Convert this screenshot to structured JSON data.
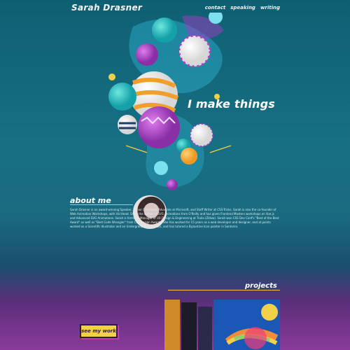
{
  "header": {
    "brand": "Sarah Drasner",
    "nav": [
      {
        "label": "contact"
      },
      {
        "label": "speaking"
      },
      {
        "label": "writing"
      }
    ]
  },
  "hero": {
    "tagline": "I make things"
  },
  "about": {
    "heading": "about me",
    "paragraphs": [
      "Sarah Drasner is an award-winning Speaker, Senior Developer Advocate at Microsoft, and Staff Writer at CSS-Tricks. Sarah is also the co-founder of Web Animation Workshops, with Val Head. She's the author of SVG Animations from O'Reilly and has given Frontend Masters workshops on Vue.js and Advanced SVG Animations. Sarah is formerly Manager of UX Design & Engineering at Trulia (Zillow). Sarah won CSS Dev Conf's \"Best of the Best Award\" as well as \"Best Code Wrangler\" from CSS Design Awards. She has worked for 15 years as a web developer and designer, and at points worked as a Scientific Illustrator and an Undergraduate Professor, and has tutored a Byzantine Icon painter in Santorini."
    ]
  },
  "projects": {
    "heading": "projects",
    "see_label": "see my work"
  },
  "colors": {
    "accent_yellow": "#f0d244",
    "teal_bg": "#176f83",
    "purple_bg": "#8a3a9a"
  }
}
